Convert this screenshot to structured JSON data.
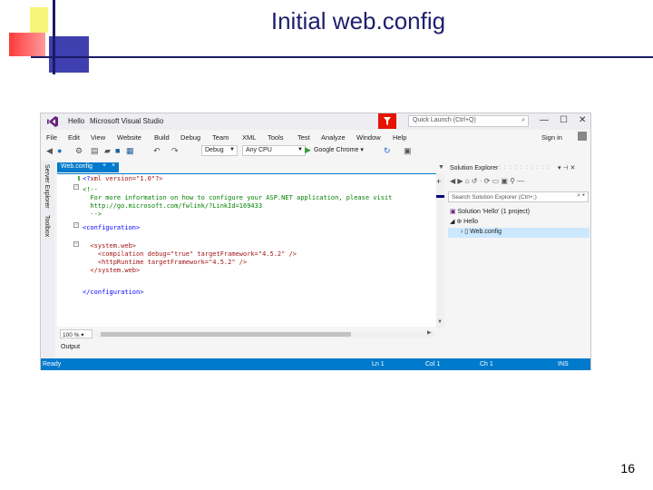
{
  "slide": {
    "title": "Initial web.config",
    "page_number": "16"
  },
  "vs": {
    "title_hello": "Hello",
    "title_app": "Microsoft Visual Studio",
    "quick_launch_placeholder": "Quick Launch (Ctrl+Q)",
    "menu": [
      "File",
      "Edit",
      "View",
      "Website",
      "Build",
      "Debug",
      "Team",
      "XML",
      "Tools",
      "Test",
      "Analyze",
      "Window",
      "Help"
    ],
    "sign_in": "Sign in",
    "toolbar": {
      "config": "Debug",
      "platform": "Any CPU",
      "browser": "Google Chrome"
    },
    "left_tabs": [
      "Server Explorer",
      "Toolbox"
    ],
    "editor_tab": "Web.config",
    "code_lines": [
      "<?xml version=\"1.0\"?>",
      "<!--",
      "  For more information on how to configure your ASP.NET application, please visit",
      "  http://go.microsoft.com/fwlink/?LinkId=169433",
      "  -->",
      "<configuration>",
      "  <system.web>",
      "    <compilation debug=\"true\" targetFramework=\"4.5.2\" />",
      "    <httpRuntime targetFramework=\"4.5.2\" />",
      "  </system.web>",
      "</configuration>"
    ],
    "zoom": "100 %",
    "output_tab": "Output",
    "solution_explorer": {
      "title": "Solution Explorer",
      "search_placeholder": "Search Solution Explorer (Ctrl+;)",
      "solution": "Solution 'Hello' (1 project)",
      "project": "Hello",
      "file": "Web.config"
    },
    "status": {
      "ready": "Ready",
      "ln": "Ln 1",
      "col": "Col 1",
      "ch": "Ch 1",
      "ins": "INS"
    },
    "colors": {
      "accent": "#007acc",
      "notification": "#e51400",
      "logo": "#68217a"
    }
  }
}
